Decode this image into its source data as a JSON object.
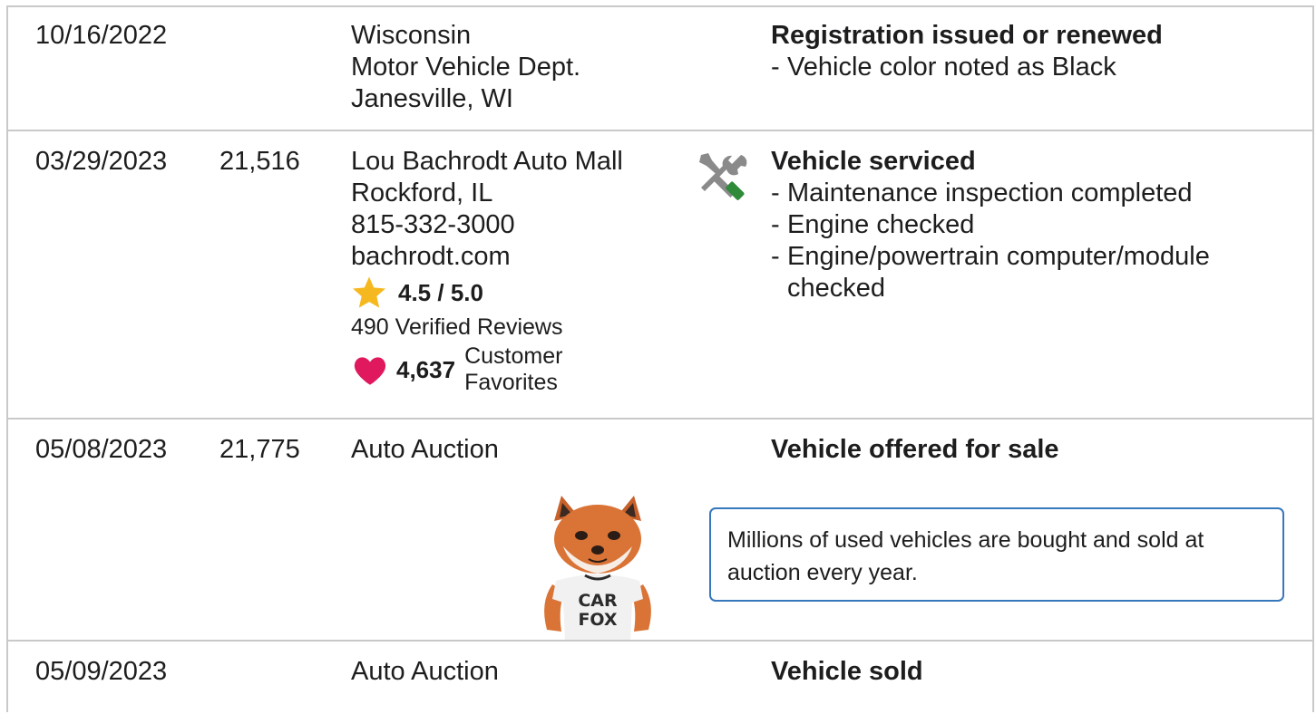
{
  "records": [
    {
      "date": "10/16/2022",
      "mileage": "",
      "source": [
        "Wisconsin",
        "Motor Vehicle Dept.",
        "Janesville, WI"
      ],
      "event": "Registration issued or renewed",
      "details": [
        "Vehicle color noted as Black"
      ]
    },
    {
      "date": "03/29/2023",
      "mileage": "21,516",
      "source": [
        "Lou Bachrodt Auto Mall",
        "Rockford, IL",
        "815-332-3000",
        "bachrodt.com"
      ],
      "rating": "4.5 / 5.0",
      "reviews": "490 Verified Reviews",
      "favorites_count": "4,637",
      "favorites_label_1": "Customer",
      "favorites_label_2": "Favorites",
      "event_icon": "service-wrench-screwdriver-icon",
      "event": "Vehicle serviced",
      "details": [
        "Maintenance inspection completed",
        "Engine checked",
        "Engine/powertrain computer/module checked"
      ]
    },
    {
      "date": "05/08/2023",
      "mileage": "21,775",
      "source": [
        "Auto Auction"
      ],
      "event": "Vehicle offered for sale",
      "callout": "Millions of used vehicles are bought and sold at auction every year.",
      "mascot_shirt_1": "CAR",
      "mascot_shirt_2": "FOX"
    },
    {
      "date": "05/09/2023",
      "mileage": "",
      "source": [
        "Auto Auction"
      ],
      "event": "Vehicle sold"
    }
  ],
  "colors": {
    "border": "#c9c9c9",
    "star": "#f5b91f",
    "heart": "#e0195f",
    "callout_border": "#3777bc",
    "icon_gray": "#8a8a8a",
    "icon_green": "#2f8a3a"
  }
}
